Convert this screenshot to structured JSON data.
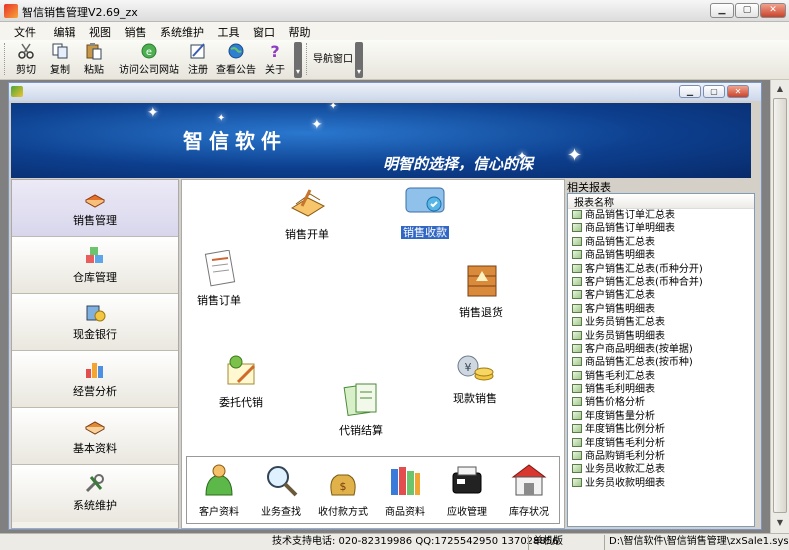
{
  "window": {
    "title": "智信销售管理V2.69_zx",
    "btn_min": "▁",
    "btn_max": "▢",
    "btn_close": "✕"
  },
  "menu": [
    "文件",
    "编辑",
    "视图",
    "销售",
    "系统维护",
    "工具",
    "窗口",
    "帮助"
  ],
  "toolbar": {
    "cut": "剪切",
    "copy": "复制",
    "paste": "粘贴",
    "visit_site": "访问公司网站",
    "register": "注册",
    "notice": "查看公告",
    "about": "关于",
    "nav_window": "导航窗口"
  },
  "banner": {
    "brand": "智信软件",
    "slogan": "明智的选择，信心的保"
  },
  "nav": [
    "销售管理",
    "仓库管理",
    "现金银行",
    "经营分析",
    "基本资料",
    "系统维护"
  ],
  "flow": {
    "sales_order_open": "销售开单",
    "sales_receipt": "销售收款",
    "sales_order": "销售订单",
    "sales_return": "销售退货",
    "consignment": "委托代销",
    "cash_sale": "现款销售",
    "consignment_settle": "代销结算"
  },
  "bottom": [
    "客户资料",
    "业务查找",
    "收付款方式",
    "商品资料",
    "应收管理",
    "库存状况"
  ],
  "reports": {
    "header": "相关报表",
    "column": "报表名称",
    "items": [
      "商品销售订单汇总表",
      "商品销售订单明细表",
      "商品销售汇总表",
      "商品销售明细表",
      "客户销售汇总表(币种分开)",
      "客户销售汇总表(币种合并)",
      "客户销售汇总表",
      "客户销售明细表",
      "业务员销售汇总表",
      "业务员销售明细表",
      "客户商品明细表(按单据)",
      "商品销售汇总表(按币种)",
      "销售毛利汇总表",
      "销售毛利明细表",
      "销售价格分析",
      "年度销售量分析",
      "年度销售比例分析",
      "年度销售毛利分析",
      "商品购销毛利分析",
      "业务员收款汇总表",
      "业务员收款明细表"
    ]
  },
  "status": {
    "support": "技术支持电话: 020-82319986 QQ:1725542950 137028856",
    "mode": "单机版",
    "path": "D:\\智信软件\\智信销售管理\\zxSale1.sys"
  },
  "colors": {
    "banner": "#0d3f8e",
    "selected": "#3166c4",
    "accent": "#c8432a"
  }
}
